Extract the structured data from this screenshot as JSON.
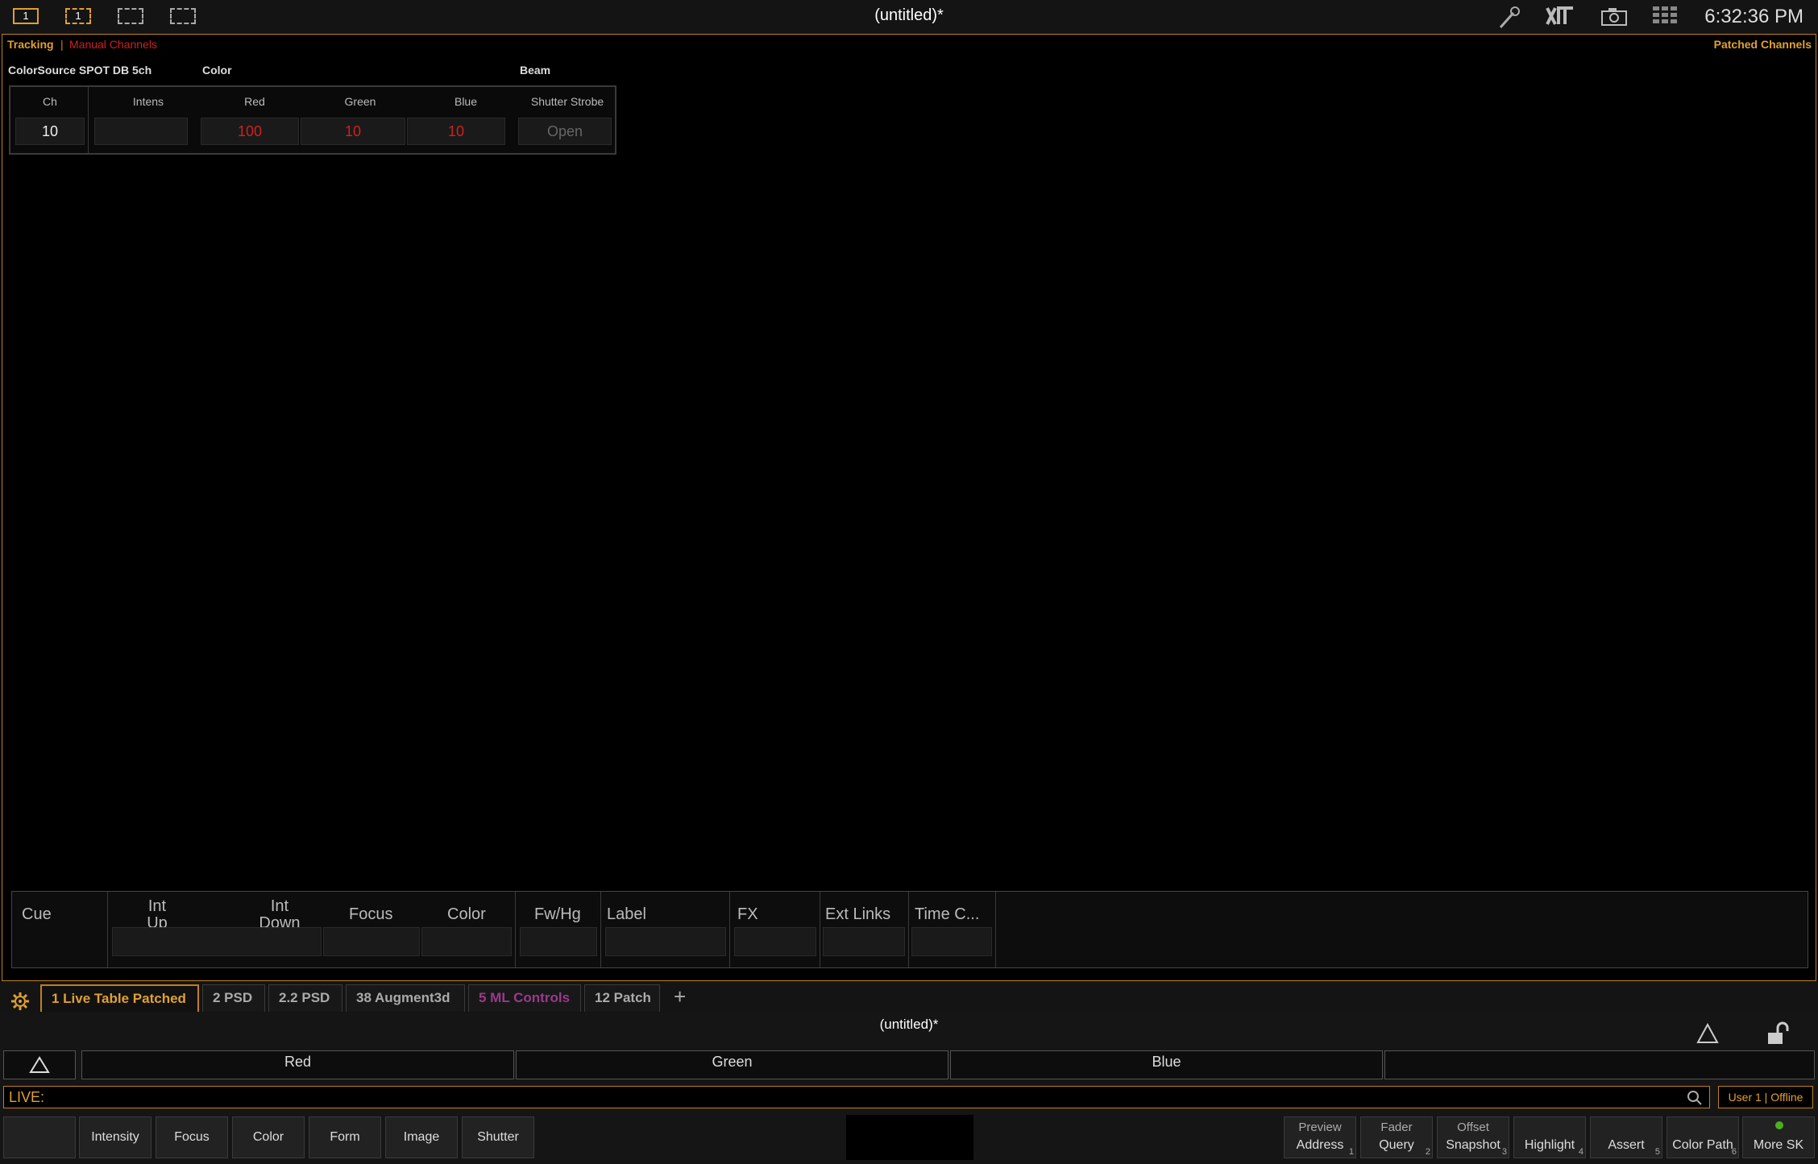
{
  "header": {
    "monitor_buttons": [
      "1",
      "1",
      "",
      ""
    ],
    "title": "(untitled)*",
    "icons": [
      "magic-wand-icon",
      "etc-logo-icon",
      "camera-icon",
      "keyboard-icon"
    ],
    "clock": "6:32:36 PM"
  },
  "main": {
    "mode_tracking": "Tracking",
    "mode_separator": "|",
    "mode_manual": "Manual Channels",
    "patched_channels": "Patched Channels",
    "fixture_type": "ColorSource SPOT DB 5ch",
    "group_color": "Color",
    "group_beam": "Beam",
    "columns": [
      "Ch",
      "Intens",
      "Red",
      "Green",
      "Blue",
      "Shutter Strobe"
    ],
    "row": {
      "ch": "10",
      "intens": "",
      "red": "100",
      "green": "10",
      "blue": "10",
      "shutter": "Open"
    }
  },
  "cue_list": {
    "headers": [
      "Cue",
      "Int Up",
      "Int Down",
      "Focus",
      "Color",
      "Fw/Hg",
      "Label",
      "FX",
      "Ext Links",
      "Time C..."
    ],
    "int_up_lines": [
      "Int",
      "Up"
    ],
    "int_down_lines": [
      "Int",
      "Down"
    ]
  },
  "tabs": [
    {
      "label": "1 Live Table Patched",
      "active": true
    },
    {
      "label": "2 PSD"
    },
    {
      "label": "2.2 PSD"
    },
    {
      "label": "38 Augment3d"
    },
    {
      "label": "5 ML Controls",
      "color": "#9a3a8a"
    },
    {
      "label": "12 Patch"
    }
  ],
  "add_tab": "+",
  "show_title": "(untitled)*",
  "encoders": [
    "Red",
    "Green",
    "Blue",
    ""
  ],
  "command_line": {
    "prompt": "LIVE:",
    "value": ""
  },
  "user_status": "User 1 | Offline",
  "param_buttons": [
    "",
    "Intensity",
    "Focus",
    "Color",
    "Form",
    "Image",
    "Shutter"
  ],
  "softkeys": [
    {
      "upper": "Preview",
      "lower": "Address",
      "num": "1"
    },
    {
      "upper": "Fader",
      "lower": "Query",
      "num": "2"
    },
    {
      "upper": "Offset",
      "lower": "Snapshot",
      "num": "3"
    },
    {
      "upper": "",
      "lower": "Highlight",
      "num": "4"
    },
    {
      "upper": "",
      "lower": "Assert",
      "num": "5"
    },
    {
      "upper": "",
      "lower": "Color Path",
      "num": "6"
    },
    {
      "upper": "",
      "lower": "More SK",
      "num": ""
    }
  ],
  "colors": {
    "accent": "#e0a030",
    "manual": "#d02020",
    "led": "#4caf20"
  }
}
